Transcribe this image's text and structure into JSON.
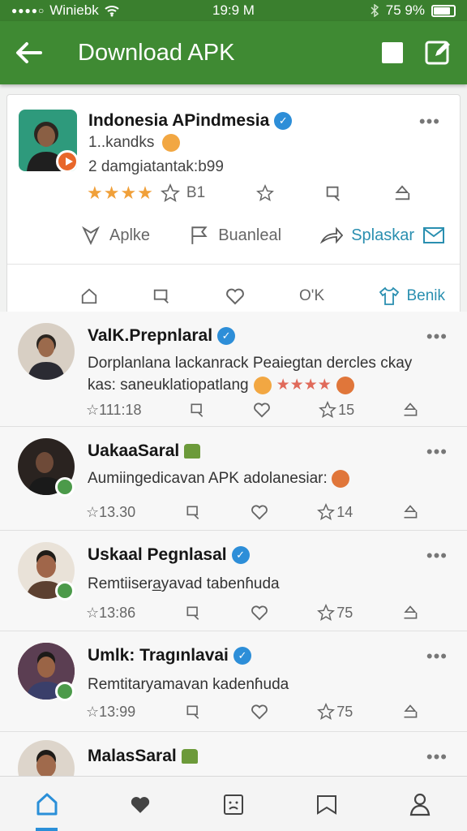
{
  "status": {
    "carrier": "Winiebk",
    "time": "19:9 M",
    "battery": "75 9%",
    "battery_level": 0.75
  },
  "appbar": {
    "title": "Download APK"
  },
  "pinned": {
    "name": "Indonesia APindmesia",
    "handle": "1..kandks",
    "subtitle": "2 damgiatantak:b99",
    "rating_stars": "★★★★",
    "rating_count": "B1",
    "actions": [
      {
        "label": "Aplke"
      },
      {
        "label": "Buanleal"
      },
      {
        "label": "Splaskar"
      }
    ],
    "bottom": {
      "ok": "O'K",
      "benik": "Benik"
    },
    "accent": "#2a8fb0"
  },
  "posts": [
    {
      "name": "ValK.Prepnlaral",
      "verified": true,
      "line1": "Dorplanlana lackanrack Peaiegtan dercles ckay",
      "line2": "kas: saneuklatiopatlang",
      "stars": "★★★★",
      "time": "☆111:18",
      "likes": "15"
    },
    {
      "name": "UakaaSaral",
      "verified": false,
      "line1": "Aumiingedicavan  APK adolanesiar:",
      "time": "☆13.30",
      "likes": "14"
    },
    {
      "name": "Uskaal Pegnlasal",
      "verified": true,
      "line1": "Remtiisera̲yavad tabenɦuda",
      "time": "☆13:86",
      "likes": "75"
    },
    {
      "name": "Umlk: Tragınlavai",
      "verified": true,
      "line1": "Remtitaryamavan kadenɦuda",
      "time": "☆13:99",
      "likes": "75"
    },
    {
      "name": "MalasSaral",
      "verified": false
    }
  ],
  "colors": {
    "green": "#3f8a33",
    "tab_active": "#2a8fd8"
  }
}
